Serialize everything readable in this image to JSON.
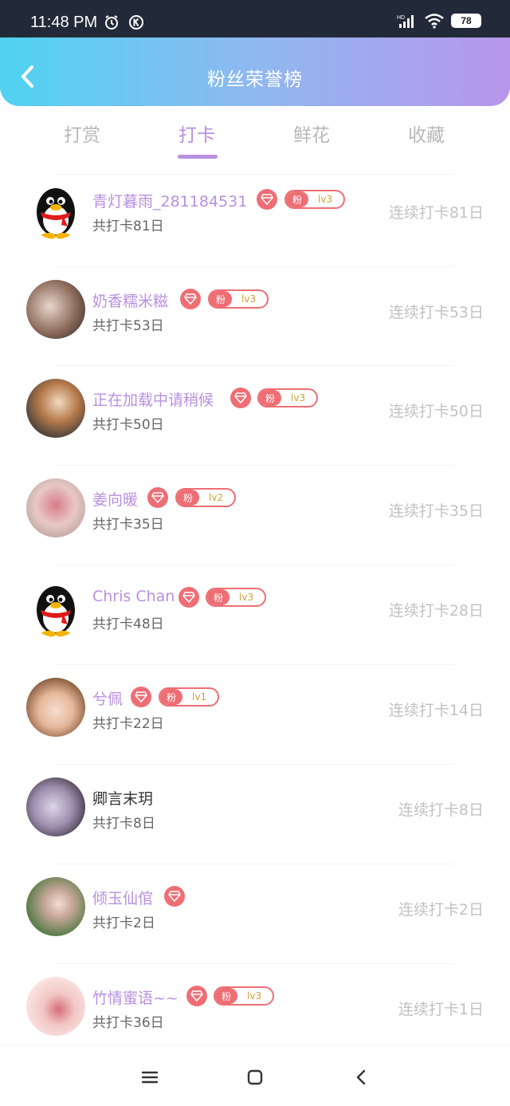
{
  "status_bar": {
    "time": "11:48 PM",
    "battery": "78",
    "network": "HD"
  },
  "header": {
    "title": "粉丝荣誉榜"
  },
  "tabs": [
    {
      "label": "打赏",
      "active": false
    },
    {
      "label": "打卡",
      "active": true
    },
    {
      "label": "鲜花",
      "active": false
    },
    {
      "label": "收藏",
      "active": false
    }
  ],
  "fans": [
    {
      "name": "青灯暮雨_281184531",
      "total": "共打卡81日",
      "streak": "连续打卡81日",
      "badge_fen": "粉",
      "level": "lv3",
      "avatar": "penguin"
    },
    {
      "name": "奶香糯米糍",
      "total": "共打卡53日",
      "streak": "连续打卡53日",
      "badge_fen": "粉",
      "level": "lv3",
      "avatar": "photo"
    },
    {
      "name": "正在加载中请稍候",
      "total": "共打卡50日",
      "streak": "连续打卡50日",
      "badge_fen": "粉",
      "level": "lv3",
      "avatar": "anime"
    },
    {
      "name": "姜向暖",
      "total": "共打卡35日",
      "streak": "连续打卡35日",
      "badge_fen": "粉",
      "level": "lv2",
      "avatar": "photo"
    },
    {
      "name": "Chris Chan",
      "total": "共打卡48日",
      "streak": "连续打卡28日",
      "badge_fen": "粉",
      "level": "lv3",
      "avatar": "penguin"
    },
    {
      "name": "兮佩",
      "total": "共打卡22日",
      "streak": "连续打卡14日",
      "badge_fen": "粉",
      "level": "lv1",
      "avatar": "anime-girl"
    },
    {
      "name": "卿言末玥",
      "total": "共打卡8日",
      "streak": "连续打卡8日",
      "avatar": "photo"
    },
    {
      "name": "倾玉仙倌",
      "total": "共打卡2日",
      "streak": "连续打卡2日",
      "avatar": "photo-green"
    },
    {
      "name": "竹情蜜语~~",
      "total": "共打卡36日",
      "streak": "连续打卡1日",
      "badge_fen": "粉",
      "level": "lv3",
      "avatar": "photo-pink"
    }
  ],
  "colors": {
    "accent": "#b98fe0",
    "badge": "#ee6e74",
    "gradient_start": "#4fd3f0",
    "gradient_end": "#b896ea"
  },
  "icons": {
    "back": "chevron-left-icon",
    "diamond": "diamond-icon",
    "nav_menu": "menu-icon",
    "nav_home": "square-icon",
    "nav_back": "back-icon"
  }
}
